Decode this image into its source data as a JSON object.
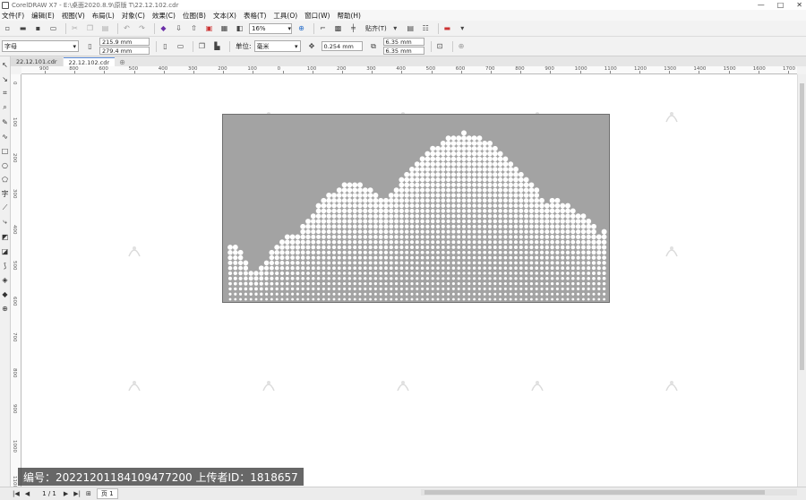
{
  "window": {
    "title": "CorelDRAW X7 - E:\\桌面2020.8.9\\原版 T\\22.12.102.cdr",
    "controls": [
      "—",
      "□",
      "✕"
    ]
  },
  "menu": [
    "文件(F)",
    "编辑(E)",
    "视图(V)",
    "布局(L)",
    "对象(C)",
    "效果(C)",
    "位图(B)",
    "文本(X)",
    "表格(T)",
    "工具(O)",
    "窗口(W)",
    "帮助(H)"
  ],
  "toolbar": {
    "zoom": "16%",
    "snap_label": "贴齐(T)"
  },
  "property_bar": {
    "paper_preset": "字母",
    "width": "215.9 mm",
    "height": "279.4 mm",
    "unit_label": "单位:",
    "unit_value": "毫米",
    "nudge": "0.254 mm",
    "dup_x": "6.35 mm",
    "dup_y": "6.35 mm"
  },
  "tabs": [
    {
      "label": "22.12.101.cdr",
      "active": false
    },
    {
      "label": "22.12.102.cdr",
      "active": true
    }
  ],
  "ruler": {
    "h_labels": [
      "900",
      "800",
      "600",
      "500",
      "400",
      "300",
      "200",
      "100",
      "0",
      "100",
      "200",
      "300",
      "400",
      "500",
      "600",
      "700",
      "800",
      "900",
      "1000",
      "1100",
      "1200",
      "1300",
      "1400",
      "1500",
      "1600",
      "1700"
    ],
    "v_labels": [
      "0",
      "100",
      "200",
      "300",
      "400",
      "500",
      "600",
      "700",
      "800",
      "900",
      "1000",
      "1100"
    ]
  },
  "artwork": {
    "panel_color": "#a3a3a3",
    "dot_color": "#ffffff"
  },
  "status": {
    "page_count": "1 / 1",
    "page_tab": "页 1"
  },
  "watermark_id_text": "编号：20221201184109477200 上传者ID：1818657"
}
